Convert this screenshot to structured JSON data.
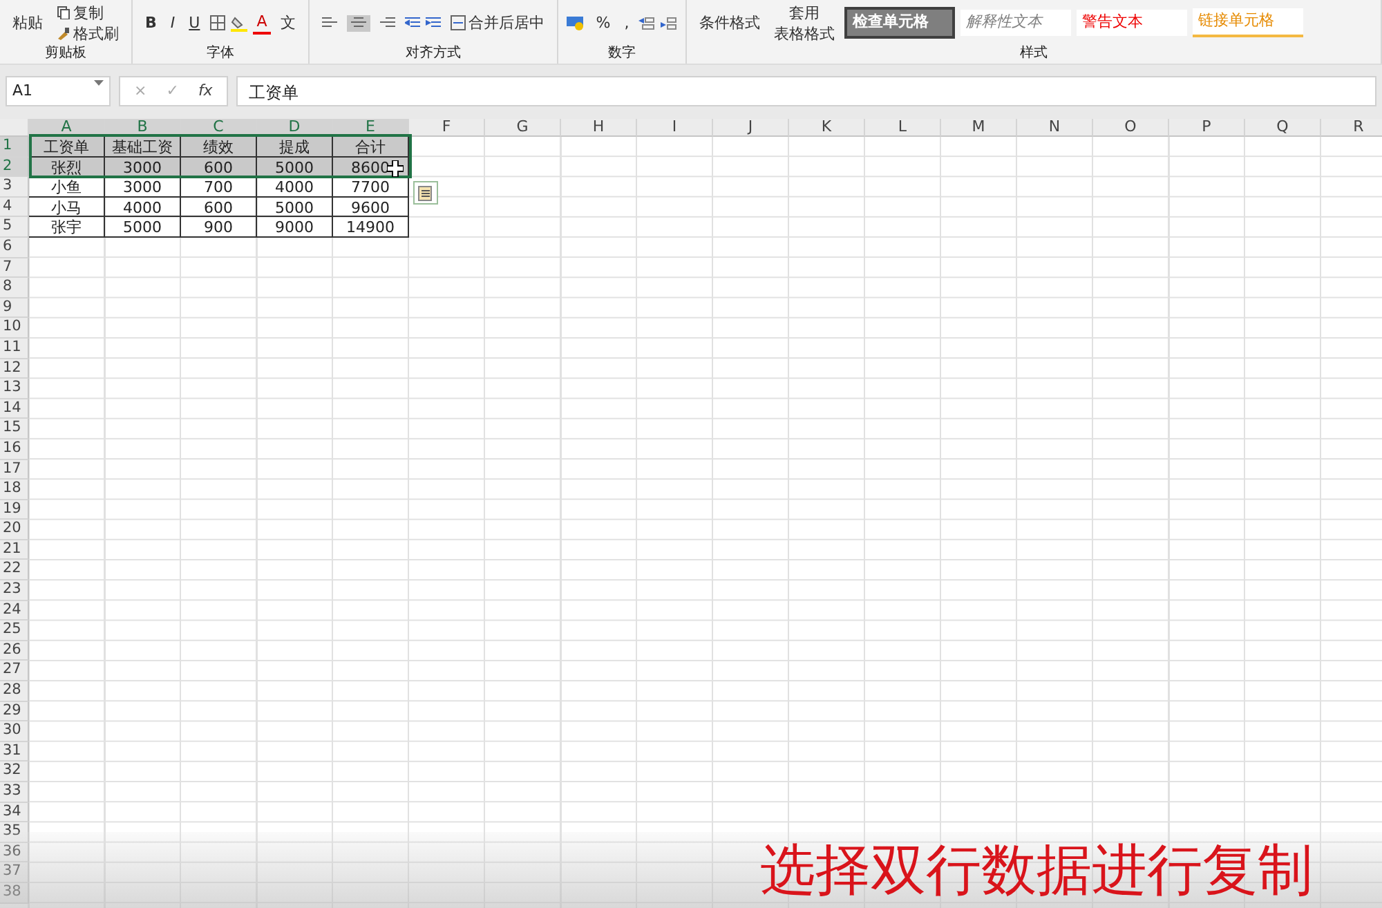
{
  "ribbon": {
    "groups": [
      {
        "label": "剪贴板",
        "kind": "clipboard",
        "paste": "粘贴",
        "copy": "复制",
        "painter": "格式刷"
      },
      {
        "label": "字体",
        "kind": "font",
        "bold": "B",
        "italic": "I",
        "underline": "U",
        "font_color": "A",
        "phonetic": "文"
      },
      {
        "label": "对齐方式",
        "kind": "align",
        "align_buttons": [
          {
            "selected": false
          },
          {
            "selected": true
          },
          {
            "selected": false
          }
        ],
        "merge": "合并后居中"
      },
      {
        "label": "数字",
        "kind": "number",
        "percent": "%",
        "comma": ","
      },
      {
        "label": "样式",
        "kind": "styles",
        "conditional": "条件格式",
        "table_format_1": "套用",
        "table_format_2": "表格格式",
        "cell_styles": [
          {
            "label": "检查单元格",
            "kind": "check"
          },
          {
            "label": "解释性文本",
            "kind": "explanatory"
          },
          {
            "label": "警告文本",
            "kind": "warning"
          },
          {
            "label": "链接单元格",
            "kind": "linked"
          }
        ]
      }
    ]
  },
  "formula_bar": {
    "name_box": "A1",
    "cancel": "×",
    "enter": "✓",
    "fx": "fx",
    "formula": "工资单"
  },
  "columns": [
    {
      "label": "A",
      "selected": true
    },
    {
      "label": "B",
      "selected": true
    },
    {
      "label": "C",
      "selected": true
    },
    {
      "label": "D",
      "selected": true
    },
    {
      "label": "E",
      "selected": true
    },
    {
      "label": "F",
      "selected": false
    },
    {
      "label": "G",
      "selected": false
    },
    {
      "label": "H",
      "selected": false
    },
    {
      "label": "I",
      "selected": false
    },
    {
      "label": "J",
      "selected": false
    },
    {
      "label": "K",
      "selected": false
    },
    {
      "label": "L",
      "selected": false
    },
    {
      "label": "M",
      "selected": false
    },
    {
      "label": "N",
      "selected": false
    },
    {
      "label": "O",
      "selected": false
    },
    {
      "label": "P",
      "selected": false
    },
    {
      "label": "Q",
      "selected": false
    },
    {
      "label": "R",
      "selected": false
    }
  ],
  "rows": [
    {
      "number": "1",
      "selected": true,
      "cells": [
        "工资单",
        "基础工资",
        "绩效",
        "提成",
        "合计"
      ]
    },
    {
      "number": "2",
      "selected": true,
      "cells": [
        "张烈",
        "3000",
        "600",
        "5000",
        "8600"
      ]
    },
    {
      "number": "3",
      "selected": false,
      "cells": [
        "小鱼",
        "3000",
        "700",
        "4000",
        "7700"
      ]
    },
    {
      "number": "4",
      "selected": false,
      "cells": [
        "小马",
        "4000",
        "600",
        "5000",
        "9600"
      ]
    },
    {
      "number": "5",
      "selected": false,
      "cells": [
        "张宇",
        "5000",
        "900",
        "9000",
        "14900"
      ]
    }
  ],
  "empty_rows": [
    "6",
    "7",
    "8",
    "9",
    "10",
    "11",
    "12",
    "13",
    "14",
    "15",
    "16",
    "17",
    "18",
    "19",
    "20",
    "21",
    "22",
    "23",
    "24",
    "25",
    "26",
    "27",
    "28",
    "29",
    "30",
    "31",
    "32",
    "33",
    "34",
    "35",
    "36",
    "37",
    "38"
  ],
  "caption": "选择双行数据进行复制"
}
